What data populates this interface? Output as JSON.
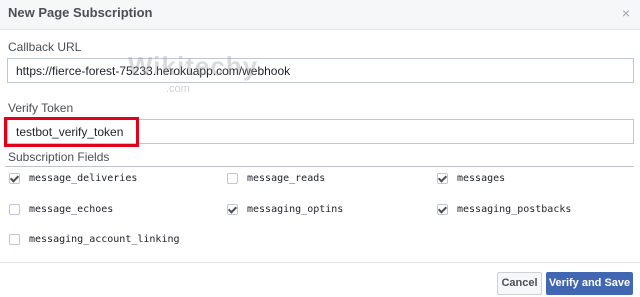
{
  "dialog": {
    "title": "New Page Subscription",
    "close_glyph": "×"
  },
  "callback": {
    "label": "Callback URL",
    "value": "https://fierce-forest-75233.herokuapp.com/webhook"
  },
  "verify": {
    "label": "Verify Token",
    "value": "testbot_verify_token"
  },
  "subscription": {
    "label": "Subscription Fields",
    "fields": [
      {
        "label": "message_deliveries",
        "checked": true
      },
      {
        "label": "message_reads",
        "checked": false
      },
      {
        "label": "messages",
        "checked": true
      },
      {
        "label": "message_echoes",
        "checked": false
      },
      {
        "label": "messaging_optins",
        "checked": true
      },
      {
        "label": "messaging_postbacks",
        "checked": true
      },
      {
        "label": "messaging_account_linking",
        "checked": false
      }
    ]
  },
  "watermark": {
    "text": "Wikitechy",
    "sub": ".com"
  },
  "footer": {
    "cancel_label": "Cancel",
    "submit_label": "Verify and Save"
  },
  "colors": {
    "primary": "#4267b2",
    "highlight": "#e3001b"
  }
}
